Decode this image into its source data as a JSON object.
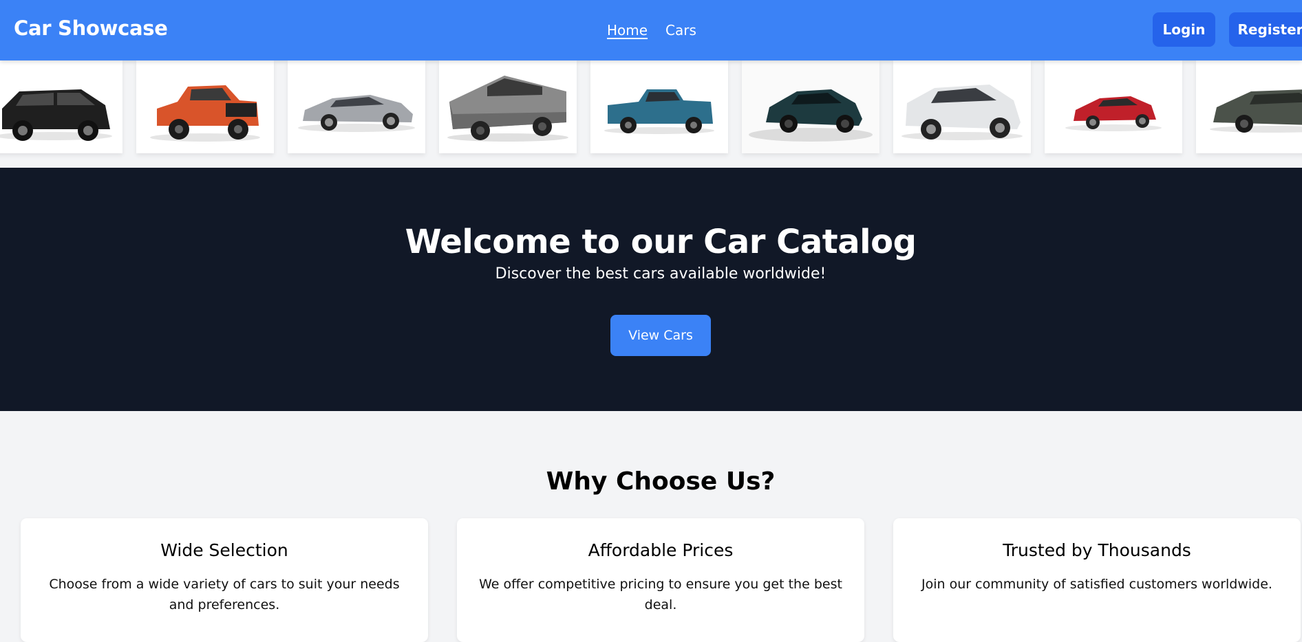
{
  "navbar": {
    "brand": "Car Showcase",
    "links": [
      "Home",
      "Cars"
    ],
    "login_label": "Login",
    "register_label": "Register",
    "color": "#3b82f6"
  },
  "carousel": {
    "cars": [
      {
        "name": "black-suv-icon",
        "color": "#1f1f1f"
      },
      {
        "name": "orange-pickup-icon",
        "color": "#d9542a"
      },
      {
        "name": "silver-sedan-icon",
        "color": "#a3a6ab"
      },
      {
        "name": "steel-truck-icon",
        "color": "#8a8a8a"
      },
      {
        "name": "teal-pickup-icon",
        "color": "#2d6f8c"
      },
      {
        "name": "dark-green-supercar-icon",
        "color": "#1d3a3f"
      },
      {
        "name": "white-suv-icon",
        "color": "#e4e6e8"
      },
      {
        "name": "red-coupe-icon",
        "color": "#c0202a"
      },
      {
        "name": "olive-suv-icon",
        "color": "#4b524a"
      }
    ]
  },
  "hero": {
    "title": "Welcome to our Car Catalog",
    "subtitle": "Discover the best cars available worldwide!",
    "button": "View Cars",
    "background": "#111827"
  },
  "why": {
    "title": "Why Choose Us?",
    "features": [
      {
        "title": "Wide Selection",
        "desc": "Choose from a wide variety of cars to suit your needs and preferences."
      },
      {
        "title": "Affordable Prices",
        "desc": "We offer competitive pricing to ensure you get the best deal."
      },
      {
        "title": "Trusted by Thousands",
        "desc": "Join our community of satisfied customers worldwide."
      }
    ]
  }
}
